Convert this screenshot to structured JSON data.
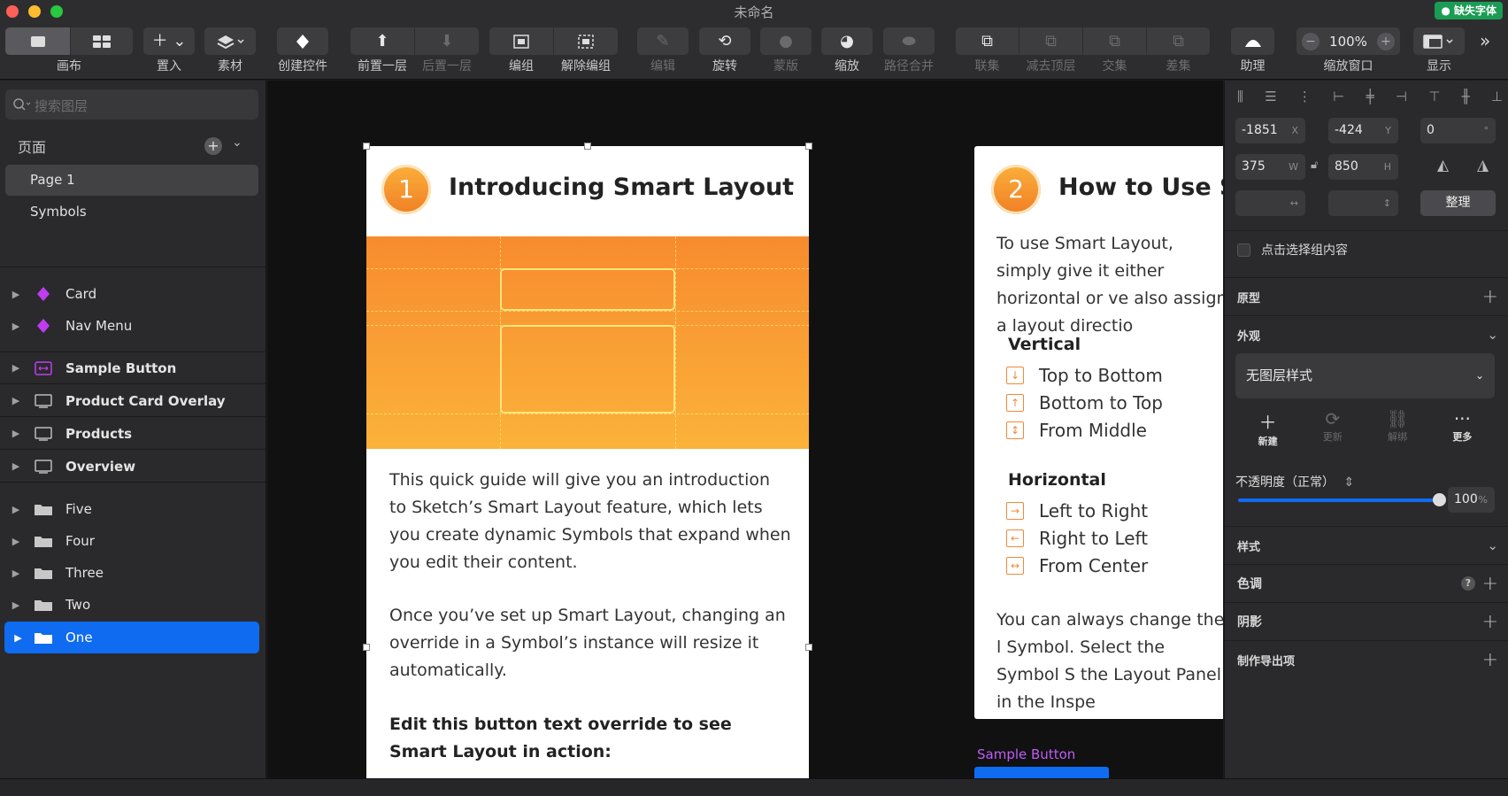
{
  "window": {
    "title": "未命名",
    "font_badge": "● 缺失字体"
  },
  "toolbar": {
    "canvas": "画布",
    "insert": "置入",
    "assets": "素材",
    "create_symbol": "创建控件",
    "forward": "前置一层",
    "backward": "后置一层",
    "group": "编组",
    "ungroup": "解除编组",
    "edit": "编辑",
    "rotate": "旋转",
    "mask": "蒙版",
    "scale": "缩放",
    "flatten": "路径合并",
    "union": "联集",
    "subtract": "减去顶层",
    "intersect": "交集",
    "difference": "差集",
    "assistant": "助理",
    "zoom_label": "缩放窗口",
    "zoom_value": "100%",
    "view": "显示"
  },
  "left": {
    "search_placeholder": "搜索图层",
    "pages_label": "页面",
    "pages": [
      "Page 1",
      "Symbols"
    ],
    "layers": [
      {
        "name": "Card",
        "icon": "symbol-icon"
      },
      {
        "name": "Nav Menu",
        "icon": "symbol-icon"
      },
      {
        "name": "Sample Button",
        "icon": "smart-layout-icon"
      },
      {
        "name": "Product Card Overlay",
        "icon": "artboard-icon"
      },
      {
        "name": "Products",
        "icon": "artboard-icon"
      },
      {
        "name": "Overview",
        "icon": "artboard-icon"
      },
      {
        "name": "Five",
        "icon": "folder-icon"
      },
      {
        "name": "Four",
        "icon": "folder-icon"
      },
      {
        "name": "Three",
        "icon": "folder-icon"
      },
      {
        "name": "Two",
        "icon": "folder-icon"
      },
      {
        "name": "One",
        "icon": "folder-icon"
      }
    ]
  },
  "card1": {
    "num": "1",
    "title": "Introducing Smart Layout",
    "p1": "This quick guide will give you an introduction to Sketch’s Smart Layout feature, which lets you create dynamic Symbols that expand when you edit their content.",
    "p2": "Once you’ve set up Smart Layout, changing an override in a Symbol’s instance will resize it automatically.",
    "p3": "Edit this button text override to see Smart Layout in action:"
  },
  "card2": {
    "num": "2",
    "title": "How to Use Sm",
    "intro": "To use Smart Layout, simply give it either horizontal or ve also assign a layout directio",
    "vertical": "Vertical",
    "v_items": [
      "Top to Bottom",
      "Bottom to Top",
      "From Middle"
    ],
    "horizontal": "Horizontal",
    "h_items": [
      "Left to Right",
      "Right to Left",
      "From Center"
    ],
    "outro": "You can always change the l Symbol. Select the Symbol S the Layout Panel in the Inspe"
  },
  "canvas_label": "Sample Button",
  "inspector": {
    "x": "-1851",
    "y": "-424",
    "rot": "0",
    "w": "375",
    "h": "850",
    "x_u": "X",
    "y_u": "Y",
    "rot_u": "°",
    "w_u": "W",
    "h_u": "H",
    "tidy": "整理",
    "click_through": "点击选择组内容",
    "prototype": "原型",
    "appearance": "外观",
    "layer_style": "无图层样式",
    "style_actions": [
      "新建",
      "更新",
      "解绑",
      "更多"
    ],
    "opacity_label": "不透明度（正常）",
    "opacity_value": "100",
    "opacity_unit": "%",
    "style": "样式",
    "tint": "色调",
    "shadow": "阴影",
    "export": "制作导出项"
  }
}
